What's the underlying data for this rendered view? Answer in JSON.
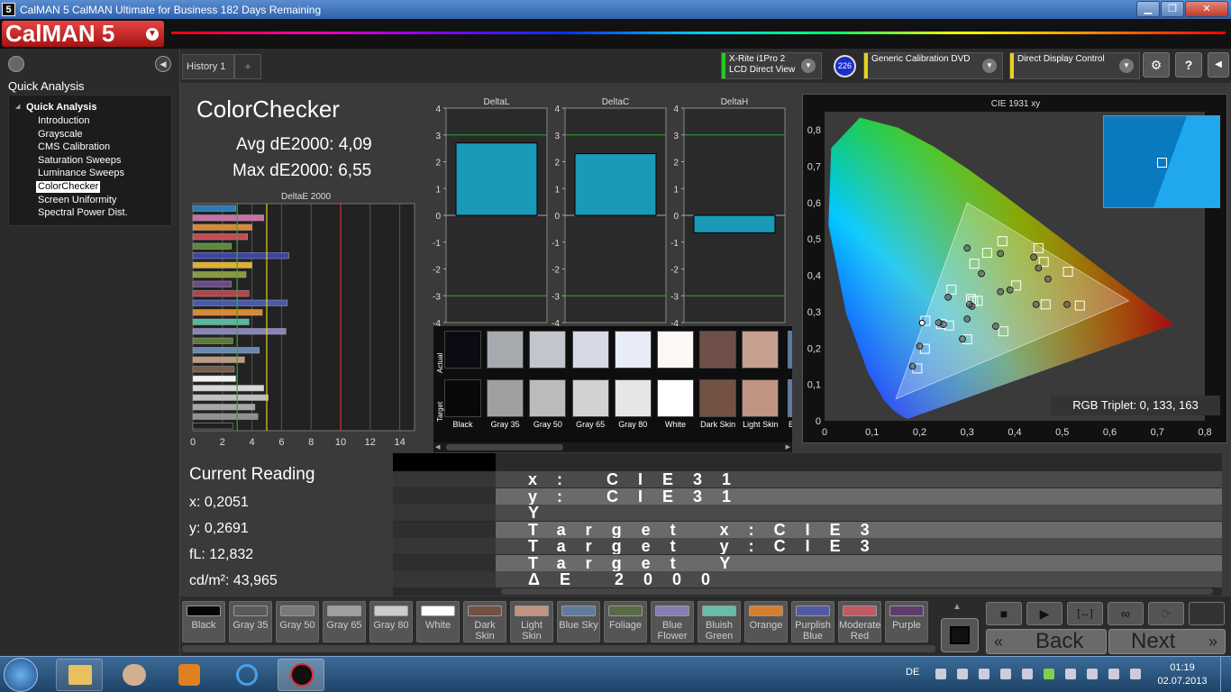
{
  "window": {
    "title": "CalMAN 5 CalMAN Ultimate for Business 182 Days Remaining",
    "min": "▁",
    "max": "❐",
    "close": "✕"
  },
  "brand": {
    "logo": "CalMAN 5"
  },
  "sidebar": {
    "title": "Quick Analysis",
    "root": "Quick Analysis",
    "items": [
      "Introduction",
      "Grayscale",
      "CMS Calibration",
      "Saturation Sweeps",
      "Luminance Sweeps",
      "ColorChecker",
      "Screen Uniformity",
      "Spectral Power Dist."
    ],
    "selected": "ColorChecker"
  },
  "tabs": [
    {
      "label": "History 1"
    }
  ],
  "devices": {
    "meter": {
      "line1": "X-Rite i1Pro 2",
      "line2": "LCD Direct View",
      "badge": "226",
      "color": "#22cc22"
    },
    "source": {
      "label": "Generic Calibration DVD",
      "color": "#e8d21a"
    },
    "display": {
      "label": "Direct Display Control",
      "color": "#e8d21a"
    }
  },
  "colorchecker": {
    "title": "ColorChecker",
    "avg": "Avg dE2000: 4,09",
    "max": "Max dE2000: 6,55"
  },
  "deltae_chart": {
    "title": "DeltaE 2000",
    "x_ticks": [
      "0",
      "2",
      "4",
      "6",
      "8",
      "10",
      "12",
      "14"
    ],
    "xlim": [
      0,
      15
    ],
    "thresholds": [
      {
        "value": 3,
        "color": "#33aa33"
      },
      {
        "value": 5,
        "color": "#e0d020"
      },
      {
        "value": 10,
        "color": "#cc3333"
      }
    ],
    "bars": [
      {
        "value": 2.9,
        "color": "#2a7cb8"
      },
      {
        "value": 4.8,
        "color": "#c96ea8"
      },
      {
        "value": 4.0,
        "color": "#d98a2e"
      },
      {
        "value": 3.7,
        "color": "#c54a55"
      },
      {
        "value": 2.6,
        "color": "#5d8a3a"
      },
      {
        "value": 6.5,
        "color": "#3a46a8"
      },
      {
        "value": 4.0,
        "color": "#e0b030"
      },
      {
        "value": 3.6,
        "color": "#8a9a40"
      },
      {
        "value": 2.6,
        "color": "#6b4a8a"
      },
      {
        "value": 3.8,
        "color": "#b8424a"
      },
      {
        "value": 6.4,
        "color": "#4a5aa8"
      },
      {
        "value": 4.7,
        "color": "#d88a30"
      },
      {
        "value": 3.8,
        "color": "#56b8a0"
      },
      {
        "value": 6.3,
        "color": "#8884c0"
      },
      {
        "value": 2.7,
        "color": "#5d7a3a"
      },
      {
        "value": 4.5,
        "color": "#6a88b0"
      },
      {
        "value": 3.5,
        "color": "#c09a80"
      },
      {
        "value": 2.8,
        "color": "#7a5a48"
      },
      {
        "value": 2.9,
        "color": "#f2f2f2"
      },
      {
        "value": 4.8,
        "color": "#d8d8d8"
      },
      {
        "value": 5.1,
        "color": "#c0c0c0"
      },
      {
        "value": 4.2,
        "color": "#a8a8a8"
      },
      {
        "value": 4.4,
        "color": "#909090"
      },
      {
        "value": 2.7,
        "color": "#202020"
      }
    ]
  },
  "delta_charts": {
    "y_ticks": [
      "4",
      "3",
      "2",
      "1",
      "0",
      "-1",
      "-2",
      "-3",
      "-4"
    ],
    "ylim": [
      -4,
      4
    ],
    "charts": [
      {
        "title": "DeltaL",
        "value": 2.7
      },
      {
        "title": "DeltaC",
        "value": 2.3
      },
      {
        "title": "DeltaH",
        "value": -0.65
      }
    ]
  },
  "swatches": {
    "actual_label": "Actual",
    "target_label": "Target",
    "items": [
      {
        "label": "Black",
        "actual": "#0c0a12",
        "target": "#080808"
      },
      {
        "label": "Gray 35",
        "actual": "#a6aaae",
        "target": "#a0a0a0"
      },
      {
        "label": "Gray 50",
        "actual": "#c2c6cc",
        "target": "#bcbcbc"
      },
      {
        "label": "Gray 65",
        "actual": "#d6dae4",
        "target": "#d2d2d2"
      },
      {
        "label": "Gray 80",
        "actual": "#e8ecf8",
        "target": "#e6e6e6"
      },
      {
        "label": "White",
        "actual": "#fdf8f4",
        "target": "#ffffff"
      },
      {
        "label": "Dark Skin",
        "actual": "#6e5048",
        "target": "#735244"
      },
      {
        "label": "Light Skin",
        "actual": "#c8a090",
        "target": "#c29482"
      }
    ],
    "partial_label": "B"
  },
  "cie": {
    "title": "CIE 1931 xy",
    "x_ticks": [
      "0",
      "0,1",
      "0,2",
      "0,3",
      "0,4",
      "0,5",
      "0,6",
      "0,7",
      "0,8"
    ],
    "y_ticks": [
      "0",
      "0,1",
      "0,2",
      "0,3",
      "0,4",
      "0,5",
      "0,6",
      "0,7",
      "0,8"
    ],
    "xlim": [
      0,
      0.8
    ],
    "ylim": [
      0,
      0.85
    ],
    "gamut": [
      [
        0.64,
        0.33
      ],
      [
        0.3,
        0.6
      ],
      [
        0.15,
        0.06
      ]
    ],
    "targets": [
      [
        0.374,
        0.494
      ],
      [
        0.45,
        0.475
      ],
      [
        0.461,
        0.437
      ],
      [
        0.512,
        0.41
      ],
      [
        0.342,
        0.462
      ],
      [
        0.315,
        0.432
      ],
      [
        0.403,
        0.372
      ],
      [
        0.322,
        0.33
      ],
      [
        0.308,
        0.335
      ],
      [
        0.267,
        0.361
      ],
      [
        0.465,
        0.32
      ],
      [
        0.537,
        0.317
      ],
      [
        0.211,
        0.198
      ],
      [
        0.3,
        0.224
      ],
      [
        0.376,
        0.246
      ],
      [
        0.195,
        0.144
      ],
      [
        0.262,
        0.262
      ],
      [
        0.212,
        0.275
      ],
      [
        0.245,
        0.266
      ],
      [
        0.3125,
        0.329
      ]
    ],
    "actuals": [
      [
        0.37,
        0.46
      ],
      [
        0.44,
        0.45
      ],
      [
        0.45,
        0.42
      ],
      [
        0.47,
        0.39
      ],
      [
        0.3,
        0.475
      ],
      [
        0.33,
        0.405
      ],
      [
        0.39,
        0.36
      ],
      [
        0.31,
        0.315
      ],
      [
        0.3,
        0.28
      ],
      [
        0.26,
        0.34
      ],
      [
        0.445,
        0.32
      ],
      [
        0.51,
        0.32
      ],
      [
        0.2,
        0.205
      ],
      [
        0.29,
        0.225
      ],
      [
        0.36,
        0.26
      ],
      [
        0.185,
        0.15
      ],
      [
        0.25,
        0.265
      ],
      [
        0.24,
        0.27
      ],
      [
        0.37,
        0.355
      ],
      [
        0.305,
        0.32
      ]
    ],
    "measured": [
      0.2051,
      0.2691
    ],
    "triplet": "RGB Triplet: 0, 133, 163",
    "inset_color": "#0085a3"
  },
  "current_reading": {
    "title": "Current Reading",
    "x": "x: 0,2051",
    "y": "y: 0,2691",
    "fl": "fL: 12,832",
    "cd": "cd/m²: 43,965"
  },
  "table_rows": [
    "x: CIE31",
    "y: CIE31",
    "Y",
    "Target x:CIE3",
    "Target y:CIE3",
    "Target Y",
    "ΔE 2000"
  ],
  "patches": [
    {
      "label": "Black",
      "color": "#050505"
    },
    {
      "label": "Gray 35",
      "color": "#5a5a5a"
    },
    {
      "label": "Gray 50",
      "color": "#7a7a7a"
    },
    {
      "label": "Gray 65",
      "color": "#a0a0a0"
    },
    {
      "label": "Gray 80",
      "color": "#cccccc"
    },
    {
      "label": "White",
      "color": "#ffffff"
    },
    {
      "label": "Dark Skin",
      "color": "#735244"
    },
    {
      "label": "Light Skin",
      "color": "#c29482"
    },
    {
      "label": "Blue Sky",
      "color": "#627a9d"
    },
    {
      "label": "Foliage",
      "color": "#576c43"
    },
    {
      "label": "Blue Flower",
      "color": "#8580b1"
    },
    {
      "label": "Bluish Green",
      "color": "#67bdaa"
    },
    {
      "label": "Orange",
      "color": "#d67e2c"
    },
    {
      "label": "Purplish Blue",
      "color": "#505ba6"
    },
    {
      "label": "Moderate Red",
      "color": "#c15a63"
    },
    {
      "label": "Purple",
      "color": "#5e3c6c"
    }
  ],
  "controls": {
    "back": "Back",
    "next": "Next",
    "stop": "■",
    "play": "▶",
    "step": "[↔]",
    "loop": "∞",
    "sync": "⟳"
  },
  "taskbar": {
    "lang": "DE",
    "time": "01:19",
    "date": "02.07.2013"
  }
}
